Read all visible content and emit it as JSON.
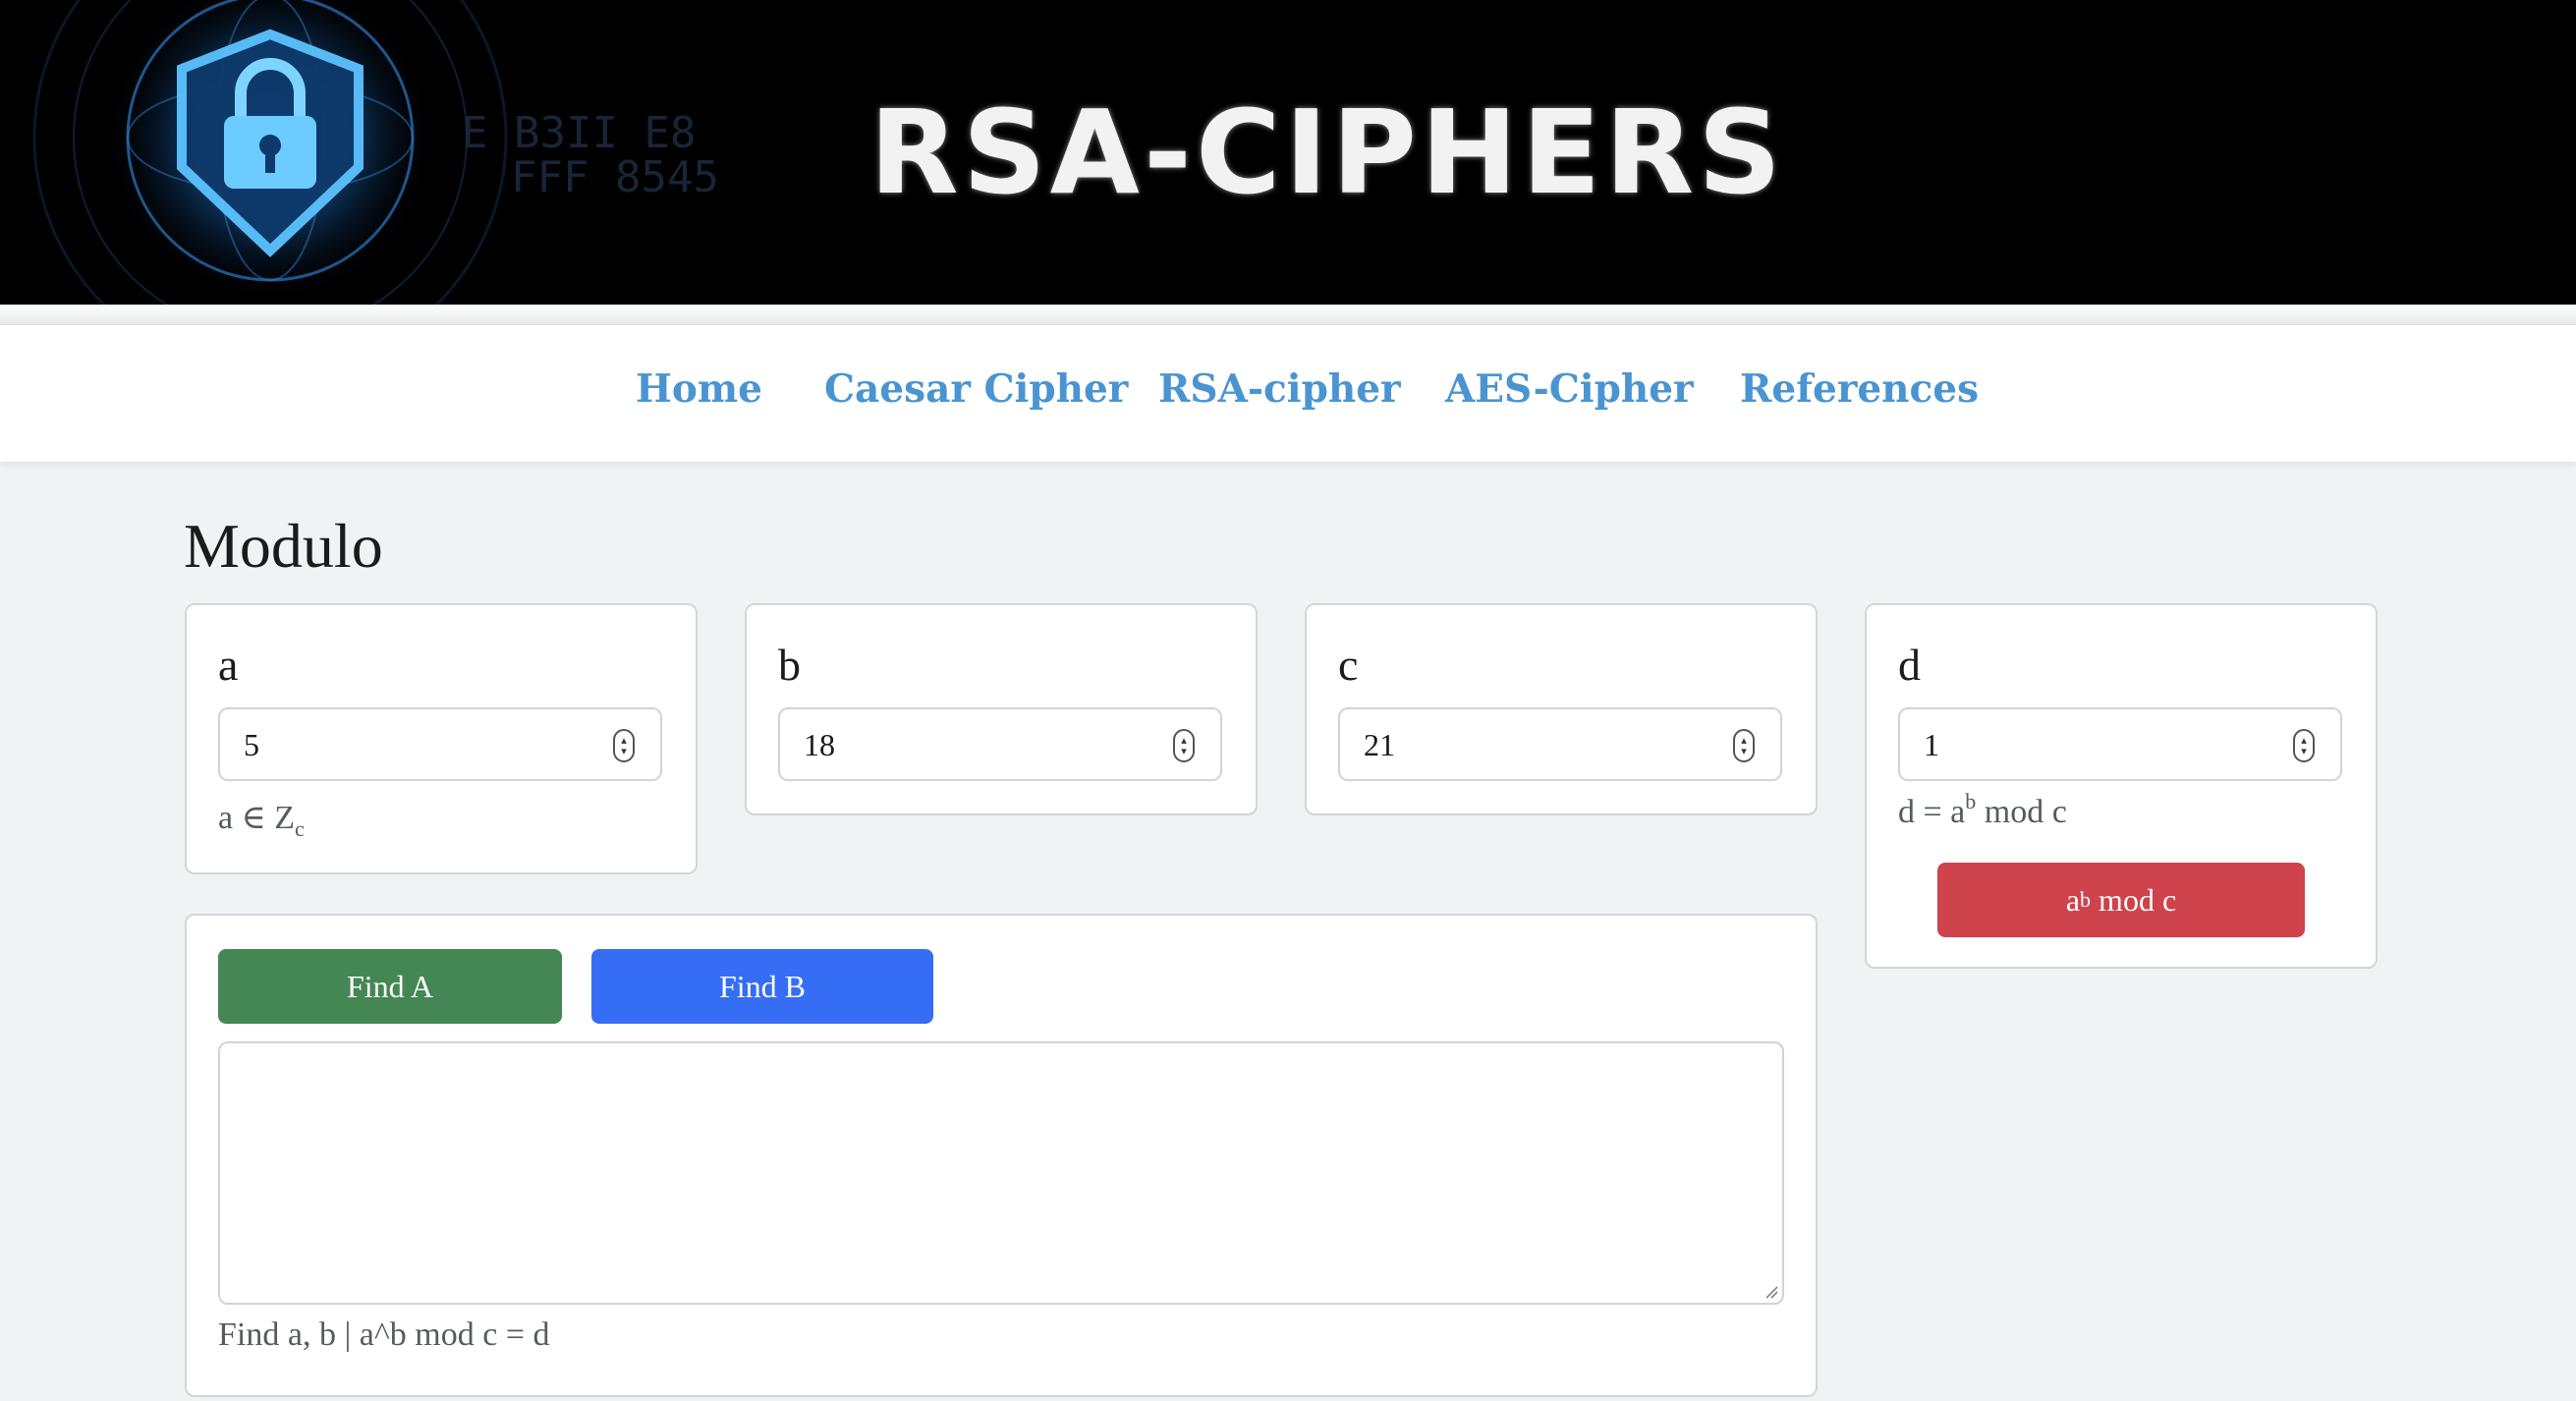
{
  "banner": {
    "title": "RSA-CIPHERS"
  },
  "nav": {
    "items": [
      "Home",
      "Caesar Cipher",
      "RSA-cipher",
      "AES-Cipher",
      "References"
    ],
    "link_color": "#4a94d2"
  },
  "page": {
    "title": "Modulo"
  },
  "fields": {
    "a": {
      "label": "a",
      "value": "5",
      "help_main": "a ∈ Z",
      "help_sub": "c"
    },
    "b": {
      "label": "b",
      "value": "18"
    },
    "c": {
      "label": "c",
      "value": "21"
    },
    "d": {
      "label": "d",
      "value": "1",
      "help_prefix": "d = a",
      "help_sup": "b",
      "help_suffix": " mod c"
    }
  },
  "buttons": {
    "compute": {
      "base": "a",
      "sup": "b",
      "suffix": " mod c",
      "color": "#cf434d"
    },
    "find_a": {
      "label": "Find A",
      "color": "#448755"
    },
    "find_b": {
      "label": "Find B",
      "color": "#356df4"
    }
  },
  "output": {
    "value": "",
    "help": "Find a, b | a^b mod c = d"
  },
  "icons": [
    "lock-shield-icon",
    "spinner-icon",
    "resize-grip-icon"
  ]
}
